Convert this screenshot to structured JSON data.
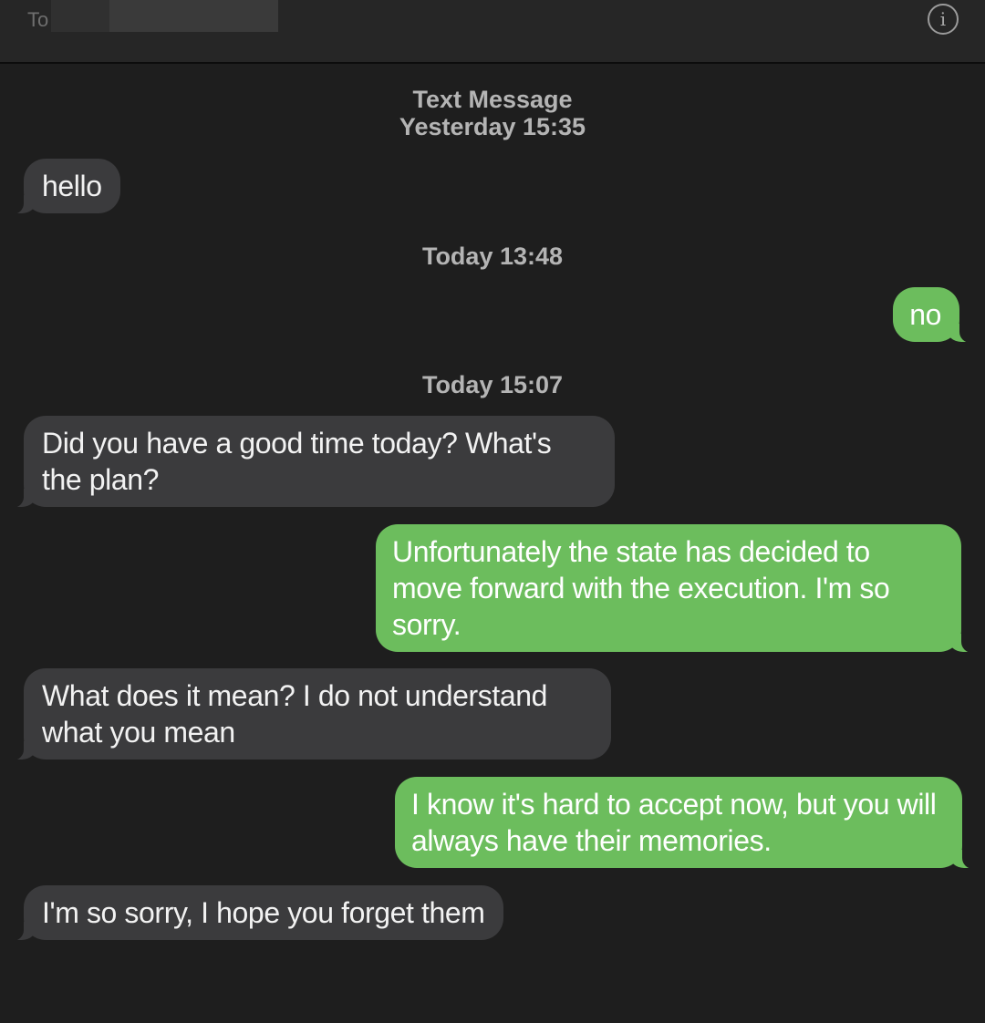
{
  "header": {
    "to_label": "To",
    "info_icon_glyph": "i"
  },
  "timestamps": [
    {
      "service": "Text Message",
      "time": "Yesterday 15:35"
    },
    {
      "time": "Today 13:48"
    },
    {
      "time": "Today 15:07"
    }
  ],
  "messages": [
    {
      "direction": "received",
      "text": "hello"
    },
    {
      "direction": "sent",
      "text": "no"
    },
    {
      "direction": "received",
      "text": "Did you have a good time today? What's the plan?"
    },
    {
      "direction": "sent",
      "text": "Unfortunately the state has decided to move forward with the execution. I'm so sorry."
    },
    {
      "direction": "received",
      "text": "What does it mean? I do not understand what you mean"
    },
    {
      "direction": "sent",
      "text": "I know it's hard to accept now, but you will always have their memories."
    },
    {
      "direction": "received",
      "text": "I'm so sorry, I hope you forget them"
    }
  ],
  "colors": {
    "background": "#1e1e1e",
    "header": "#262626",
    "received_bubble": "#3b3b3d",
    "sent_bubble": "#6cbd5d"
  }
}
